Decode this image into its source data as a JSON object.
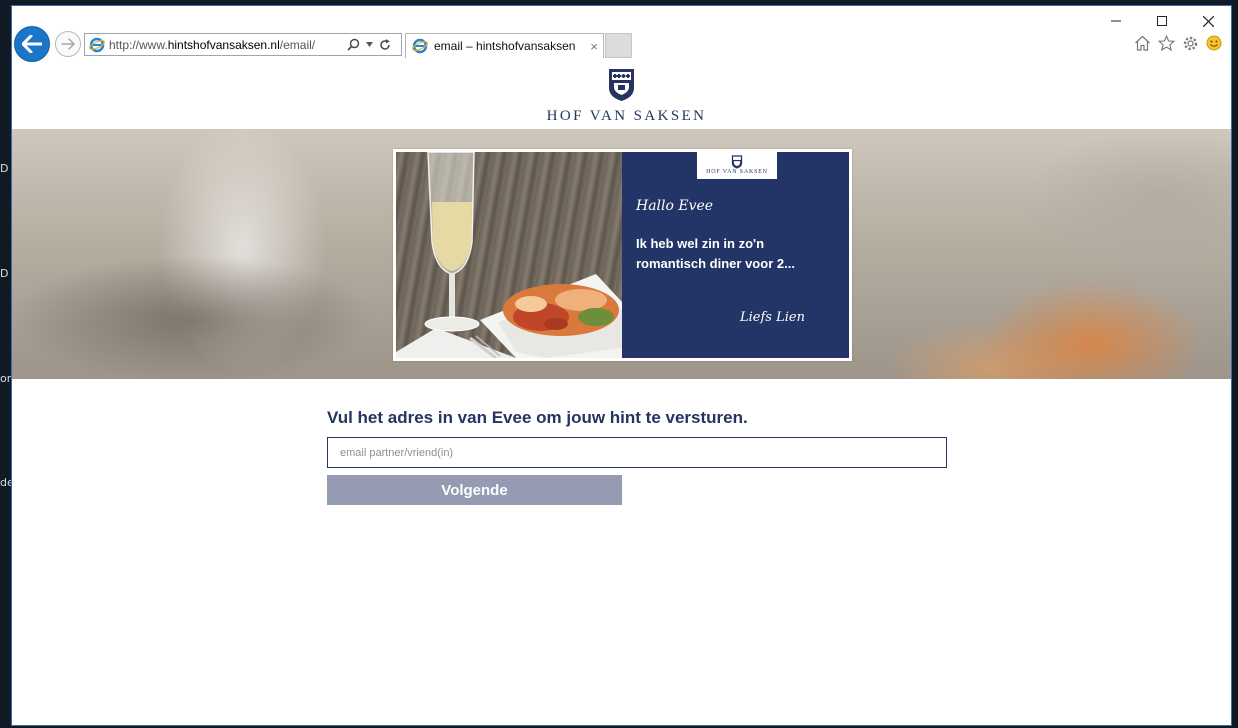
{
  "desktop": {
    "labels": [
      "D",
      "D",
      "or",
      "dec"
    ]
  },
  "browser": {
    "address_bar": {
      "url_prefix": "http://www.",
      "url_domain": "hintshofvansaksen.nl",
      "url_path": "/email/"
    },
    "tab": {
      "title": "email – hintshofvansaksen",
      "close_label": "×"
    }
  },
  "site": {
    "logo_text": "HOF VAN SAKSEN"
  },
  "card": {
    "logo_text": "HOF VAN SAKSEN",
    "greeting": "Hallo Evee",
    "message": "Ik heb wel zin in zo'n romantisch diner voor 2...",
    "signoff": "Liefs Lien"
  },
  "form": {
    "heading": "Vul het adres in van Evee om jouw hint te versturen.",
    "email_placeholder": "email partner/vriend(in)",
    "email_value": "",
    "submit_label": "Volgende"
  },
  "colors": {
    "brand_navy": "#253460",
    "button_grey": "#959bb3",
    "browser_accent": "#1b75c9"
  }
}
